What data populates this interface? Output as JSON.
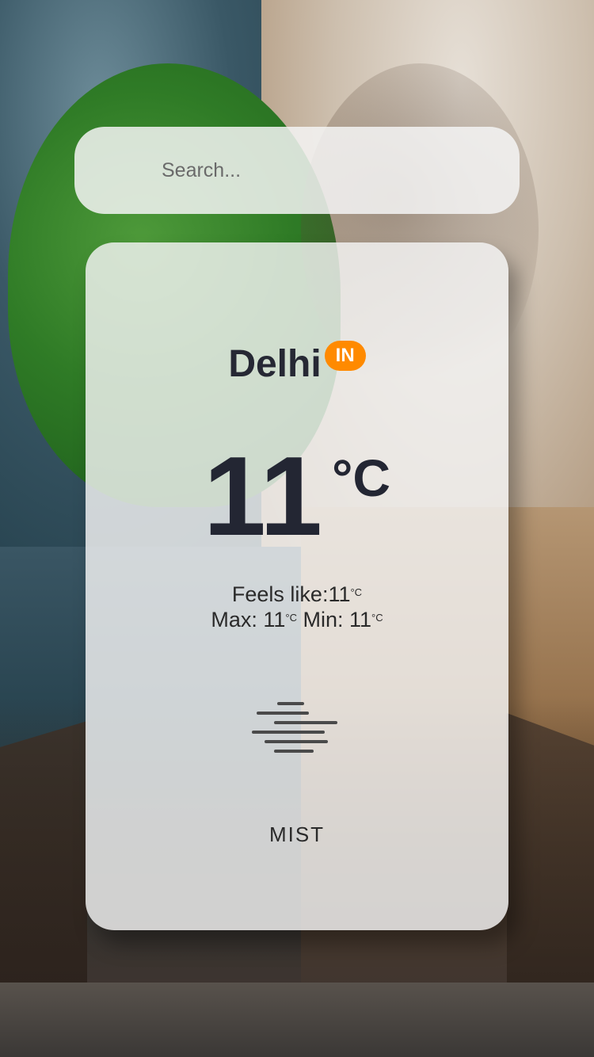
{
  "search": {
    "placeholder": "Search..."
  },
  "weather": {
    "city": "Delhi",
    "country_code": "IN",
    "temperature": "11",
    "temperature_unit": "°C",
    "feels_like_label": "Feels like:",
    "feels_like_value": "11",
    "max_label": "Max: ",
    "max_value": "11",
    "min_label": " Min: ",
    "min_value": "11",
    "small_unit": "°C",
    "condition": "MIST",
    "condition_icon": "mist-icon"
  },
  "colors": {
    "badge": "#ff8a00",
    "text_dark": "#232633"
  }
}
